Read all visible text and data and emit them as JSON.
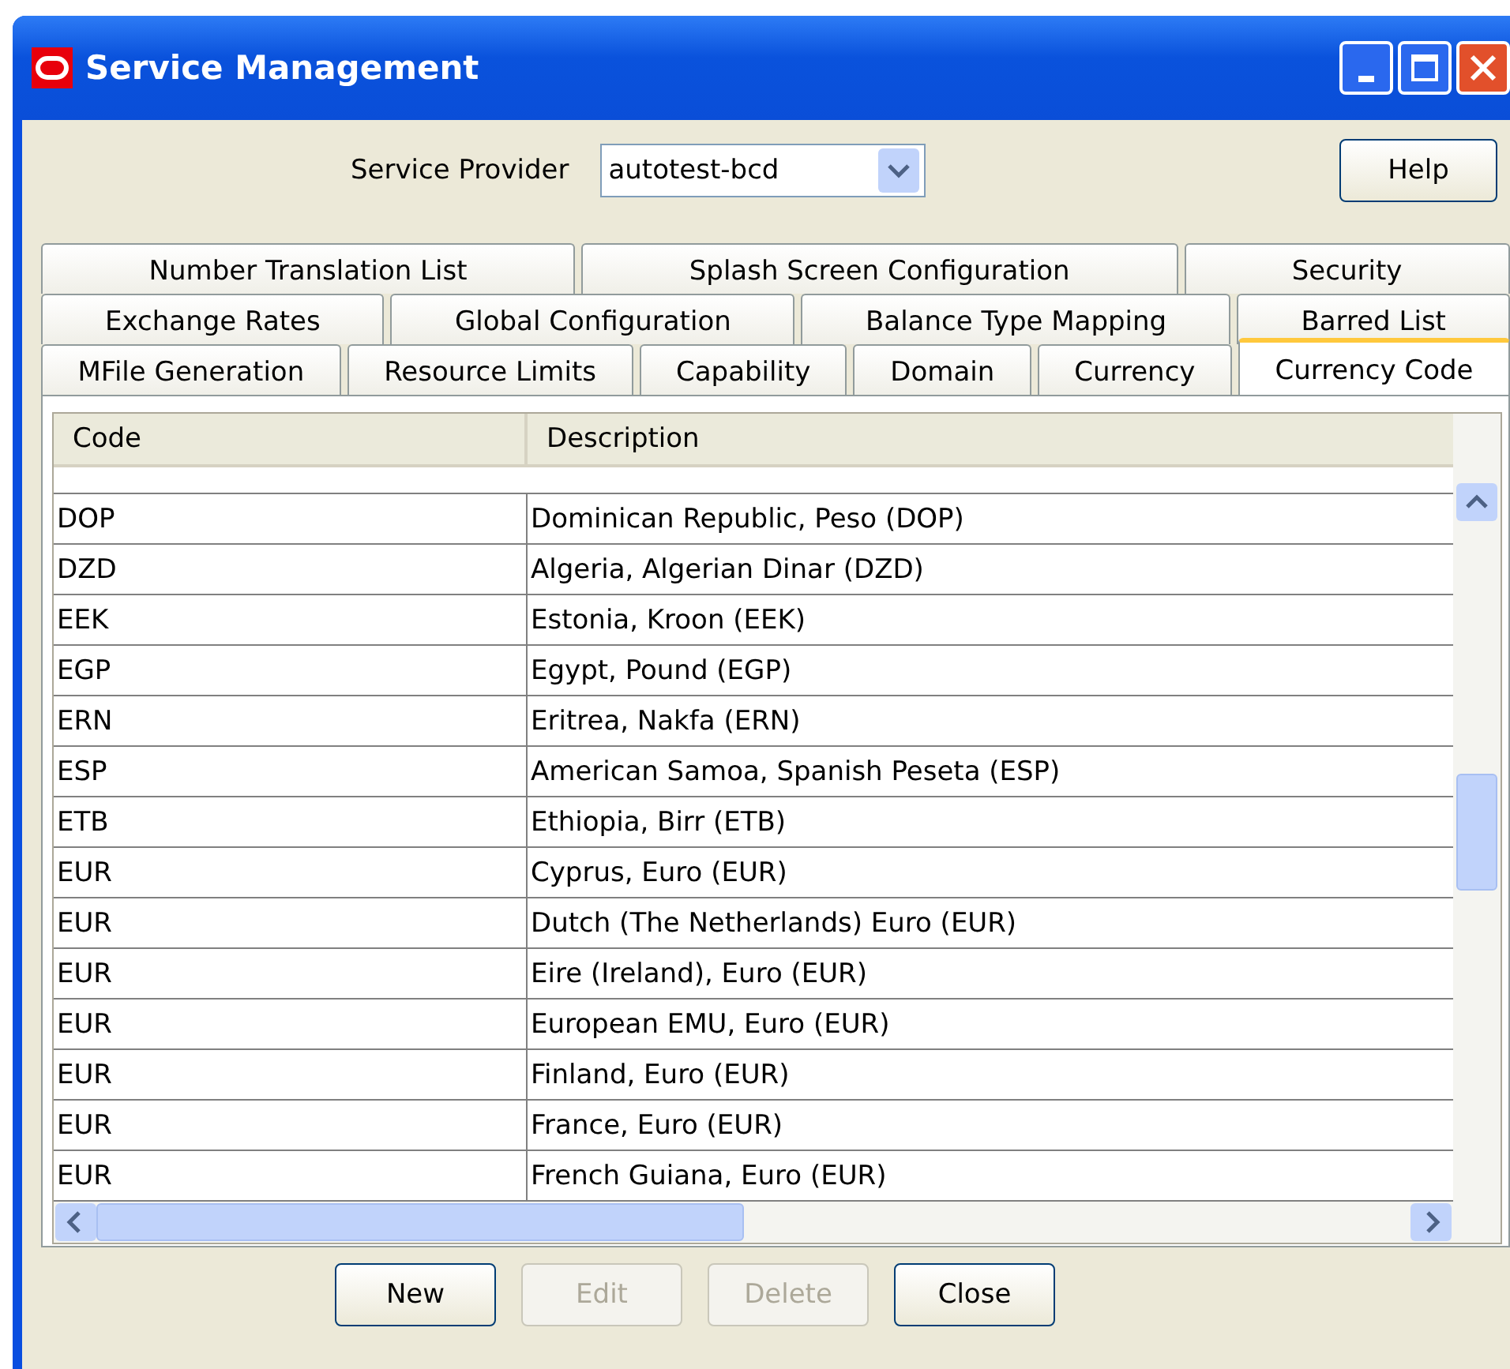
{
  "window": {
    "title": "Service Management"
  },
  "service_provider": {
    "label": "Service Provider",
    "value": "autotest-bcd"
  },
  "help_button": "Help",
  "tab_rows": [
    [
      {
        "label": "Number Translation List",
        "selected": false
      },
      {
        "label": "Splash Screen Configuration",
        "selected": false
      },
      {
        "label": "Security",
        "selected": false
      }
    ],
    [
      {
        "label": "Exchange Rates",
        "selected": false
      },
      {
        "label": "Global Configuration",
        "selected": false
      },
      {
        "label": "Balance Type Mapping",
        "selected": false
      },
      {
        "label": "Barred List",
        "selected": false
      }
    ],
    [
      {
        "label": "MFile Generation",
        "selected": false
      },
      {
        "label": "Resource Limits",
        "selected": false
      },
      {
        "label": "Capability",
        "selected": false
      },
      {
        "label": "Domain",
        "selected": false
      },
      {
        "label": "Currency",
        "selected": false
      },
      {
        "label": "Currency Code",
        "selected": true
      }
    ]
  ],
  "table": {
    "columns": [
      "Code",
      "Description"
    ],
    "rows": [
      {
        "code": "DOP",
        "description": "Dominican Republic, Peso (DOP)"
      },
      {
        "code": "DZD",
        "description": "Algeria, Algerian Dinar (DZD)"
      },
      {
        "code": "EEK",
        "description": "Estonia, Kroon (EEK)"
      },
      {
        "code": "EGP",
        "description": "Egypt, Pound (EGP)"
      },
      {
        "code": "ERN",
        "description": "Eritrea, Nakfa (ERN)"
      },
      {
        "code": "ESP",
        "description": "American Samoa, Spanish Peseta (ESP)"
      },
      {
        "code": "ETB",
        "description": "Ethiopia, Birr (ETB)"
      },
      {
        "code": "EUR",
        "description": "Cyprus, Euro (EUR)"
      },
      {
        "code": "EUR",
        "description": "Dutch (The Netherlands) Euro (EUR)"
      },
      {
        "code": "EUR",
        "description": "Eire (Ireland), Euro (EUR)"
      },
      {
        "code": "EUR",
        "description": "European EMU, Euro (EUR)"
      },
      {
        "code": "EUR",
        "description": "Finland, Euro (EUR)"
      },
      {
        "code": "EUR",
        "description": "France, Euro (EUR)"
      },
      {
        "code": "EUR",
        "description": "French Guiana, Euro (EUR)"
      }
    ]
  },
  "buttons": [
    {
      "label": "New",
      "disabled": false
    },
    {
      "label": "Edit",
      "disabled": true
    },
    {
      "label": "Delete",
      "disabled": true
    },
    {
      "label": "Close",
      "disabled": false
    }
  ]
}
